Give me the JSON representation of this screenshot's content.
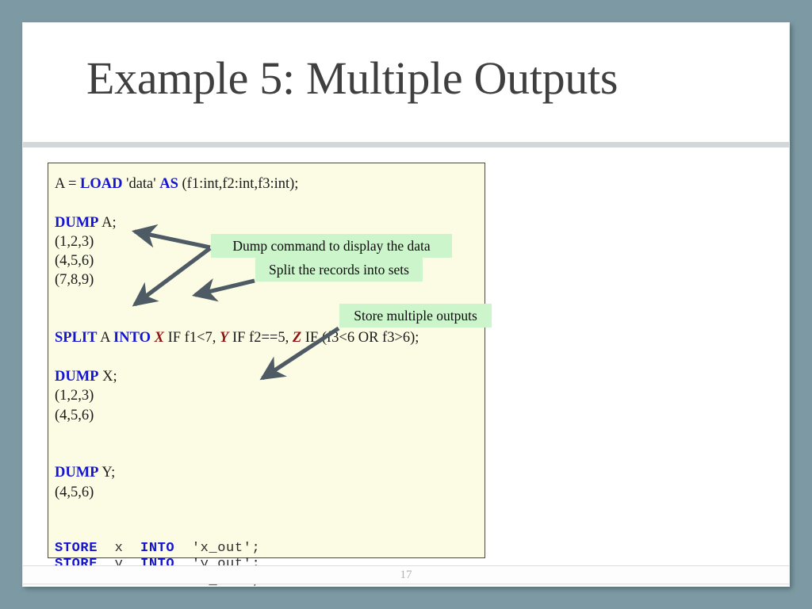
{
  "slide": {
    "title": "Example 5: Multiple Outputs",
    "page_number": "17",
    "background_color": "#7d9aa4",
    "slide_color": "#ffffff",
    "divider_color": "#d2d7d9"
  },
  "code_block": {
    "background_color": "#fcfce4",
    "border_color": "#4a4a38",
    "keyword_color": "#1414d2",
    "relation_color": "#8c1111",
    "lines": [
      {
        "id": "load",
        "type": "serif",
        "segments": [
          {
            "text": "A = ",
            "style": "plain"
          },
          {
            "text": "LOAD",
            "style": "kw"
          },
          {
            "text": " 'data' ",
            "style": "plain"
          },
          {
            "text": "AS",
            "style": "kw"
          },
          {
            "text": " (f1:int,f2:int,f3:int);",
            "style": "plain"
          }
        ]
      },
      {
        "id": "blank1",
        "type": "blank",
        "segments": []
      },
      {
        "id": "dump-a",
        "type": "serif",
        "segments": [
          {
            "text": "DUMP",
            "style": "kw"
          },
          {
            "text": " A;",
            "style": "plain"
          }
        ]
      },
      {
        "id": "a-row-1",
        "type": "serif",
        "segments": [
          {
            "text": "(1,2,3)",
            "style": "plain"
          }
        ]
      },
      {
        "id": "a-row-2",
        "type": "serif",
        "segments": [
          {
            "text": "(4,5,6)",
            "style": "plain"
          }
        ]
      },
      {
        "id": "a-row-3",
        "type": "serif",
        "segments": [
          {
            "text": "(7,8,9)",
            "style": "plain"
          }
        ]
      },
      {
        "id": "blank2",
        "type": "blank",
        "segments": []
      },
      {
        "id": "blank3",
        "type": "blank",
        "segments": []
      },
      {
        "id": "split",
        "type": "serif",
        "segments": [
          {
            "text": "SPLIT",
            "style": "kw"
          },
          {
            "text": " A ",
            "style": "plain"
          },
          {
            "text": "INTO",
            "style": "kw"
          },
          {
            "text": " ",
            "style": "plain"
          },
          {
            "text": "X",
            "style": "relvar"
          },
          {
            "text": " IF f1<7, ",
            "style": "plain"
          },
          {
            "text": "Y",
            "style": "relvar"
          },
          {
            "text": " IF f2==5, ",
            "style": "plain"
          },
          {
            "text": "Z",
            "style": "relvar"
          },
          {
            "text": " IF (f3<6 OR f3>6);",
            "style": "plain"
          }
        ]
      },
      {
        "id": "blank4",
        "type": "blank",
        "segments": []
      },
      {
        "id": "dump-x",
        "type": "serif",
        "segments": [
          {
            "text": "DUMP",
            "style": "kw"
          },
          {
            "text": " X;",
            "style": "plain"
          }
        ]
      },
      {
        "id": "x-row-1",
        "type": "serif",
        "segments": [
          {
            "text": "(1,2,3)",
            "style": "plain"
          }
        ]
      },
      {
        "id": "x-row-2",
        "type": "serif",
        "segments": [
          {
            "text": "(4,5,6)",
            "style": "plain"
          }
        ]
      },
      {
        "id": "blank5",
        "type": "blank",
        "segments": []
      },
      {
        "id": "blank6",
        "type": "blank",
        "segments": []
      },
      {
        "id": "dump-y",
        "type": "serif",
        "segments": [
          {
            "text": "DUMP",
            "style": "kw"
          },
          {
            "text": " Y;",
            "style": "plain"
          }
        ]
      },
      {
        "id": "y-row-1",
        "type": "serif",
        "segments": [
          {
            "text": "(4,5,6)",
            "style": "plain"
          }
        ]
      },
      {
        "id": "blank7",
        "type": "blank",
        "segments": []
      },
      {
        "id": "blank8",
        "type": "blank",
        "segments": []
      },
      {
        "id": "store-x",
        "type": "mono",
        "segments": [
          {
            "text": "STORE",
            "style": "kw"
          },
          {
            "text": "  x  ",
            "style": "plain"
          },
          {
            "text": "INTO",
            "style": "kw"
          },
          {
            "text": "  'x_out';",
            "style": "plain"
          }
        ]
      },
      {
        "id": "store-y",
        "type": "mono",
        "segments": [
          {
            "text": "STORE",
            "style": "kw"
          },
          {
            "text": "  y  ",
            "style": "plain"
          },
          {
            "text": "INTO",
            "style": "kw"
          },
          {
            "text": "  'y_out';",
            "style": "plain"
          }
        ]
      },
      {
        "id": "store-z",
        "type": "mono",
        "segments": [
          {
            "text": "STORE",
            "style": "kw"
          },
          {
            "text": "  z  ",
            "style": "plain"
          },
          {
            "text": "INTO",
            "style": "kw"
          },
          {
            "text": "  'z_out';",
            "style": "plain"
          }
        ]
      }
    ]
  },
  "callouts": {
    "background_color": "#ccf5cc",
    "arrow_color": "#4e5a64",
    "split": "Split the records into sets",
    "dump": "Dump command to display the data",
    "store": "Store multiple outputs"
  }
}
